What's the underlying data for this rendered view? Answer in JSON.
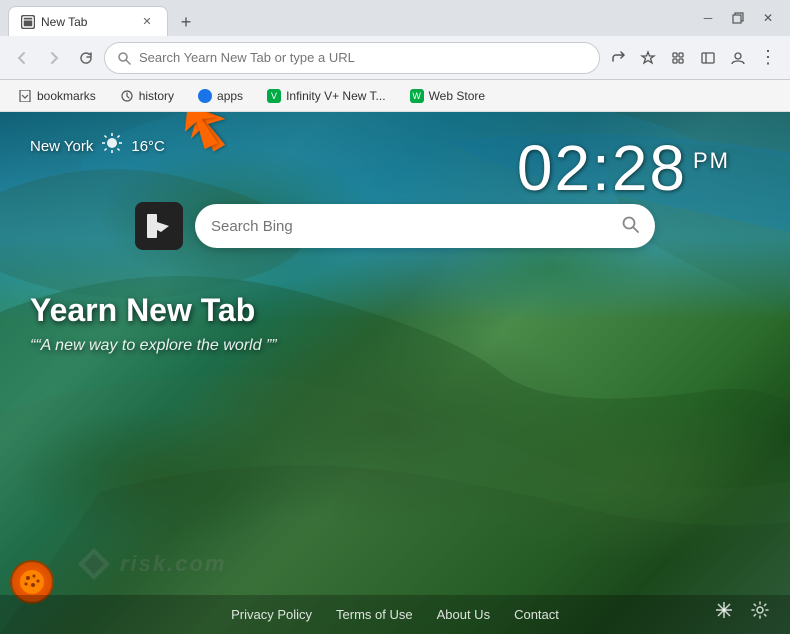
{
  "window": {
    "title": "New Tab"
  },
  "titlebar": {
    "minimize": "─",
    "maximize": "□",
    "close": "✕",
    "restore": "❐"
  },
  "tabs": [
    {
      "id": "new-tab",
      "label": "New Tab",
      "active": true,
      "favicon": "🌐"
    }
  ],
  "newtab_btn": "+",
  "toolbar": {
    "back_disabled": true,
    "forward_disabled": true,
    "reload": "↻",
    "address_placeholder": "Search Yearn New Tab or type a URL",
    "address_value": "Search Yearn New Tab or type a URL",
    "share_icon": "⬆",
    "star_icon": "☆",
    "extensions_icon": "🧩",
    "sidebar_icon": "▐",
    "profile_icon": "👤",
    "menu_icon": "⋮"
  },
  "bookmarks": [
    {
      "id": "bookmarks",
      "label": "bookmarks",
      "favicon": "🔖"
    },
    {
      "id": "history",
      "label": "history",
      "favicon": "🕐"
    },
    {
      "id": "apps",
      "label": "apps",
      "favicon": "🔵"
    },
    {
      "id": "infinity-newtab",
      "label": "Infinity V+ New T...",
      "favicon": "🟡"
    },
    {
      "id": "web-store",
      "label": "Web Store",
      "favicon": "🟡"
    }
  ],
  "weather": {
    "city": "New York",
    "icon": "☀",
    "temp": "16°C"
  },
  "clock": {
    "time": "02:28",
    "ampm": "PM"
  },
  "search": {
    "placeholder": "Search Bing",
    "logo": "b"
  },
  "branding": {
    "title": "Yearn New Tab",
    "tagline": "A new way to explore the world"
  },
  "footer": {
    "privacy_policy": "Privacy Policy",
    "terms_of_use": "Terms of Use",
    "about_us": "About Us",
    "contact": "Contact",
    "snowflake_icon": "❄",
    "settings_icon": "⚙",
    "watermark": "risk.com"
  },
  "colors": {
    "accent_orange": "#ff6600",
    "tab_active_bg": "#ffffff",
    "toolbar_bg": "#f0f2f5",
    "address_border": "#c8ccd1"
  }
}
